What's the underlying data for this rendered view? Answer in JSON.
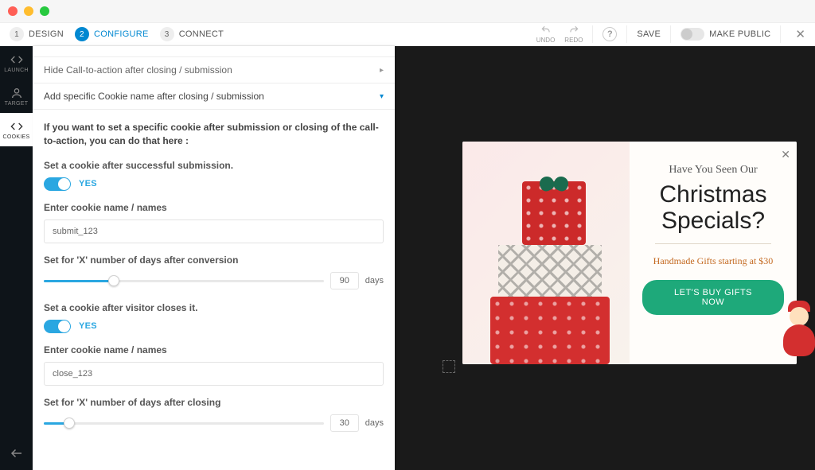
{
  "titlebar": {},
  "toolbar": {
    "steps": [
      {
        "num": "1",
        "label": "DESIGN"
      },
      {
        "num": "2",
        "label": "CONFIGURE"
      },
      {
        "num": "3",
        "label": "CONNECT"
      }
    ],
    "undo": "UNDO",
    "redo": "REDO",
    "help": "?",
    "save": "SAVE",
    "make_public": "MAKE PUBLIC",
    "close": "✕"
  },
  "sidebar": {
    "items": [
      {
        "label": "LAUNCH"
      },
      {
        "label": "TARGET"
      },
      {
        "label": "COOKIES"
      }
    ]
  },
  "panel": {
    "accordion_prev": "Hide Call-to-action after closing / submission",
    "accordion_open": "Add specific Cookie name after closing / submission",
    "lead": "If you want to set a specific cookie after submission or closing of the call-to-action, you can do that here :",
    "submit": {
      "heading": "Set a cookie after successful submission.",
      "toggle_label": "YES",
      "names_label": "Enter cookie name / names",
      "names_value": "submit_123",
      "days_label": "Set for 'X' number of days after conversion",
      "days_value": "90",
      "days_unit": "days",
      "slider_pct": 25
    },
    "close": {
      "heading": "Set a cookie after visitor closes it.",
      "toggle_label": "YES",
      "names_label": "Enter cookie name / names",
      "names_value": "close_123",
      "days_label": "Set for 'X' number of days after closing",
      "days_value": "30",
      "days_unit": "days",
      "slider_pct": 9
    }
  },
  "preview": {
    "close": "✕",
    "subhead": "Have You Seen Our",
    "title_line1": "Christmas",
    "title_line2": "Specials?",
    "offer": "Handmade Gifts starting at $30",
    "cta": "LET'S BUY GIFTS NOW"
  }
}
